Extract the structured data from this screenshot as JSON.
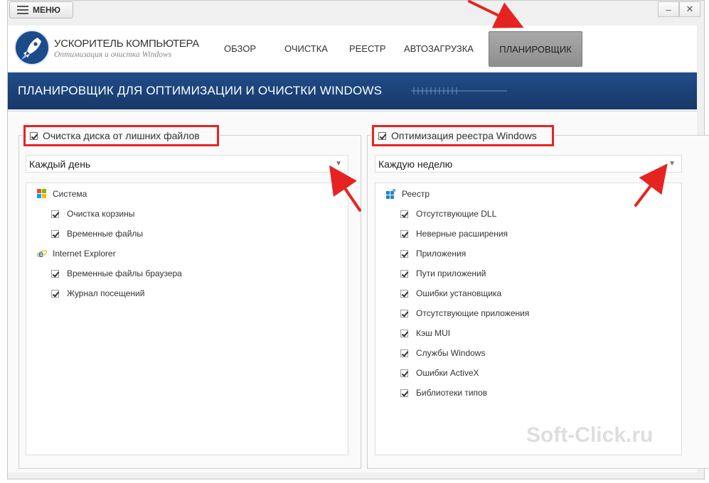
{
  "window": {
    "menu_label": "МЕНЮ",
    "minimize_glyph": "–",
    "close_glyph": "✕"
  },
  "logo": {
    "title": "УСКОРИТЕЛЬ КОМПЬЮТЕРА",
    "subtitle": "Оптимизация и очистка Windows"
  },
  "nav": {
    "items": [
      "ОБЗОР",
      "ОЧИСТКА",
      "РЕЕСТР",
      "АВТОЗАГРУЗКА",
      "ПЛАНИРОВЩИК"
    ],
    "active": "ПЛАНИРОВЩИК"
  },
  "banner": {
    "title": "ПЛАНИРОВЩИК ДЛЯ ОПТИМИЗАЦИИ И ОЧИСТКИ WINDOWS"
  },
  "left": {
    "group_title": "Очистка диска от лишних файлов",
    "schedule": "Каждый день",
    "categories": [
      {
        "name": "Система",
        "icon": "windows-icon",
        "items": [
          "Очистка корзины",
          "Временные файлы"
        ]
      },
      {
        "name": "Internet Explorer",
        "icon": "internet-explorer-icon",
        "items": [
          "Временные файлы браузера",
          "Журнал посещений"
        ]
      }
    ]
  },
  "right": {
    "group_title": "Оптимизация реестра Windows",
    "schedule": "Каждую неделю",
    "category": {
      "name": "Реестр",
      "icon": "registry-icon"
    },
    "items": [
      "Отсутствующие DLL",
      "Неверные расширения",
      "Приложения",
      "Пути приложений",
      "Ошибки установщика",
      "Отсутствующие приложения",
      "Кэш MUI",
      "Службы Windows",
      "Ошибки ActiveX",
      "Библиотеки типов"
    ]
  },
  "watermark": "Soft-Click.ru",
  "colors": {
    "banner": "#1c4580",
    "highlight": "#e52421",
    "active_tab": "#999999"
  }
}
